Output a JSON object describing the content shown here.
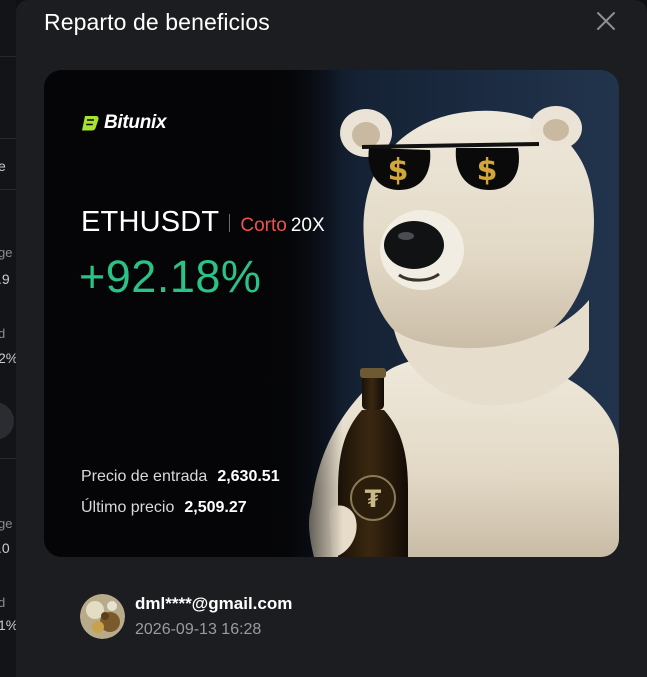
{
  "background": {
    "fragments": [
      "e",
      "ge",
      ".9",
      "d",
      "2%",
      "ge",
      ".0",
      "d",
      "1%"
    ]
  },
  "modal": {
    "title": "Reparto de beneficios",
    "close_icon": "close-icon"
  },
  "card": {
    "brand": "Bitunix",
    "pair": "ETHUSDT",
    "side": "Corto",
    "leverage": "20X",
    "roe": "+92.18%",
    "entry_label": "Precio de entrada",
    "entry_value": "2,630.51",
    "last_label": "Último precio",
    "last_value": "2,509.27",
    "illustration": "polar-bear-with-sunglasses-and-bottle"
  },
  "user": {
    "email": "dml****@gmail.com",
    "timestamp": "2026-09-13 16:28"
  },
  "colors": {
    "profit": "#2bc287",
    "short": "#f0514f",
    "brand_green": "#a6e22e",
    "modal_bg": "#1c1d20"
  }
}
